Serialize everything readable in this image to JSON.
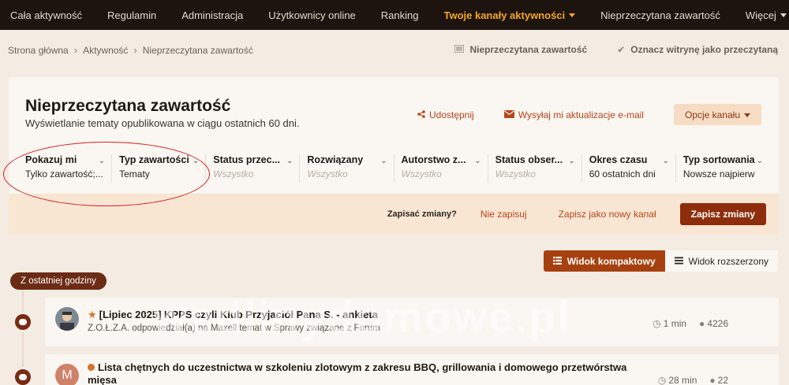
{
  "nav": {
    "items": [
      {
        "label": "Cała aktywność"
      },
      {
        "label": "Regulamin"
      },
      {
        "label": "Administracja"
      },
      {
        "label": "Użytkownicy online"
      },
      {
        "label": "Ranking"
      },
      {
        "label": "Twoje kanały aktywności"
      },
      {
        "label": "Nieprzeczytana zawartość"
      },
      {
        "label": "Więcej"
      }
    ]
  },
  "breadcrumb": {
    "items": [
      "Strona główna",
      "Aktywność",
      "Nieprzeczytana zawartość"
    ],
    "separator": "›"
  },
  "crumb_actions": {
    "unread": "Nieprzeczytana zawartość",
    "mark_read": "Oznacz witrynę jako przeczytaną"
  },
  "header": {
    "title": "Nieprzeczytana zawartość",
    "description": "Wyświetlanie tematy opublikowana w ciągu ostatnich 60 dni.",
    "share": "Udostępnij",
    "email_updates": "Wysyłaj mi aktualizacje e-mail",
    "channel_options": "Opcje kanału"
  },
  "filters": [
    {
      "label": "Pokazuj mi",
      "value": "Tylko zawartość;...",
      "muted": false
    },
    {
      "label": "Typ zawartości",
      "value": "Tematy",
      "muted": false
    },
    {
      "label": "Status przec...",
      "value": "Wszystko",
      "muted": true
    },
    {
      "label": "Rozwiązany",
      "value": "Wszystko",
      "muted": true
    },
    {
      "label": "Autorstwo z...",
      "value": "Wszystko",
      "muted": true
    },
    {
      "label": "Status obser...",
      "value": "Wszystko",
      "muted": true
    },
    {
      "label": "Okres czasu",
      "value": "60 ostatnich dni",
      "muted": false
    },
    {
      "label": "Typ sortowania",
      "value": "Nowsze najpierw",
      "muted": false
    }
  ],
  "save_bar": {
    "question": "Zapisać zmiany?",
    "dont_save": "Nie zapisuj",
    "save_new": "Zapisz jako nowy kanał",
    "save": "Zapisz zmiany"
  },
  "view_toggle": {
    "compact": "Widok kompaktowy",
    "expanded": "Widok rozszerzony"
  },
  "timeline": {
    "group_label": "Z ostatniej godziny"
  },
  "items": [
    {
      "title": "[Lipiec 2025] KPPS czyli Klub Przyjaciół Pana S. - ankieta",
      "sub": "Z.O.Ł.Z.A. odpowiedział(a) na Maxell temat w Sprawy związane z Forum",
      "time": "1 min",
      "replies": "4226",
      "status": "starred"
    },
    {
      "title": "Lista chętnych do uczestnictwa w szkoleniu zlotowym z zakresu BBQ, grillowania i domowego przetwórstwa",
      "title2": "mięsa",
      "avatar_letter": "M",
      "time": "28 min",
      "replies": "22",
      "status": "unread"
    }
  ],
  "watermark": "wedlinydomowe.pl",
  "colors": {
    "nav_bg": "#1d140f",
    "nav_active": "#f5a623",
    "accent": "#b8451c",
    "primary_btn": "#8e2d0c",
    "annotation": "#d42020"
  }
}
